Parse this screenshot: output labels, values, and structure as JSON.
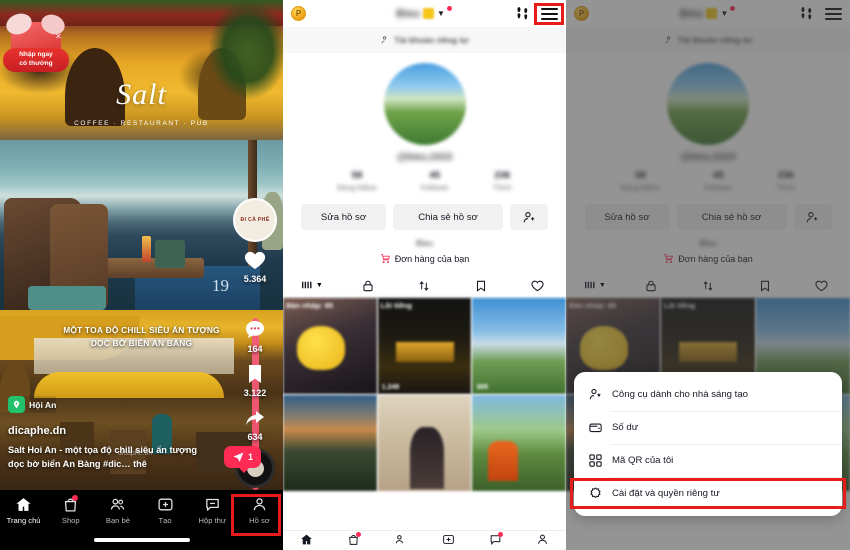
{
  "feed": {
    "promo": {
      "line1": "Nhập ngay",
      "line2": "có thưởng",
      "close_icon": "close-icon"
    },
    "video_title": "MỘT TOẠ ĐỘ CHILL SIÊU ẤN TƯỢNG\nDỌC BỜ BIỂN AN BÀNG",
    "salt_logo": "Salt",
    "salt_tagline": "COFFEE · RESTAURANT · PUB",
    "table_number": "19",
    "coffee_badge": "ĐI CÀ PHÊ",
    "rail": {
      "like_count": "5.364",
      "comment_count": "164",
      "bookmark_count": "3.122",
      "share_count": "634"
    },
    "location": "Hội An",
    "author_handle": "dicaphe.dn",
    "caption": "Salt Hoi An - một tọa độ chill siêu ấn tượng dọc bờ biển An Bàng #dic… thê",
    "watermark": "dicaphe.dn",
    "share_bubble_count": "1",
    "tabbar": [
      {
        "label": "Trang chủ",
        "icon": "home-icon",
        "active": true,
        "badge": false
      },
      {
        "label": "Shop",
        "icon": "shop-bag-icon",
        "active": false,
        "badge": true
      },
      {
        "label": "Bạn bè",
        "icon": "friends-icon",
        "active": false,
        "badge": false
      },
      {
        "label": "Tạo",
        "icon": "create-plus-icon",
        "active": false,
        "badge": false
      },
      {
        "label": "Hộp thư",
        "icon": "inbox-icon",
        "active": false,
        "badge": false
      },
      {
        "label": "Hồ sơ",
        "icon": "profile-person-icon",
        "active": false,
        "badge": false
      }
    ]
  },
  "profile": {
    "header": {
      "coin_label": "P",
      "username": "Bieu",
      "footprints_icon": "footprints-icon",
      "hamburger_icon": "hamburger-menu-icon"
    },
    "subheader": "Tài khoản riêng tư",
    "user_handle": "@bieu.2410",
    "stats": [
      {
        "value": "58",
        "label": "Đang follow"
      },
      {
        "value": "45",
        "label": "Follower"
      },
      {
        "value": "236",
        "label": "Thích"
      }
    ],
    "buttons": {
      "edit": "Sửa hồ sơ",
      "share": "Chia sẻ hồ sơ",
      "add_friend_icon": "add-person-icon"
    },
    "bio": "Bieu",
    "order_row": {
      "label": "Đơn hàng của bạn",
      "icon": "shopping-cart-icon"
    },
    "tabs": [
      {
        "icon": "grid-icon",
        "name": "posts-tab"
      },
      {
        "icon": "lock-icon",
        "name": "private-tab"
      },
      {
        "icon": "repost-icon",
        "name": "repost-tab"
      },
      {
        "icon": "bookmark-icon",
        "name": "saved-tab"
      },
      {
        "icon": "heart-icon",
        "name": "liked-tab"
      }
    ],
    "thumbnails": [
      {
        "label": "Bản nháp: 65",
        "views": ""
      },
      {
        "label": "Lồi tiếng",
        "views": "1.249"
      },
      {
        "label": "",
        "views": "305"
      },
      {
        "label": "",
        "views": ""
      },
      {
        "label": "",
        "views": ""
      },
      {
        "label": "",
        "views": ""
      }
    ]
  },
  "menu": {
    "items": [
      {
        "label": "Công cụ dành cho nhà sáng tạo",
        "icon": "creator-tools-icon",
        "highlighted": false
      },
      {
        "label": "Số dư",
        "icon": "wallet-icon",
        "highlighted": false
      },
      {
        "label": "Mã QR của tôi",
        "icon": "qr-code-icon",
        "highlighted": false
      },
      {
        "label": "Cài đặt và quyền riêng tư",
        "icon": "gear-icon",
        "highlighted": true
      }
    ]
  },
  "colors": {
    "accent_red": "#fe2c55",
    "highlight_box": "#e81b1b",
    "coin_gold": "#f0a81c"
  }
}
